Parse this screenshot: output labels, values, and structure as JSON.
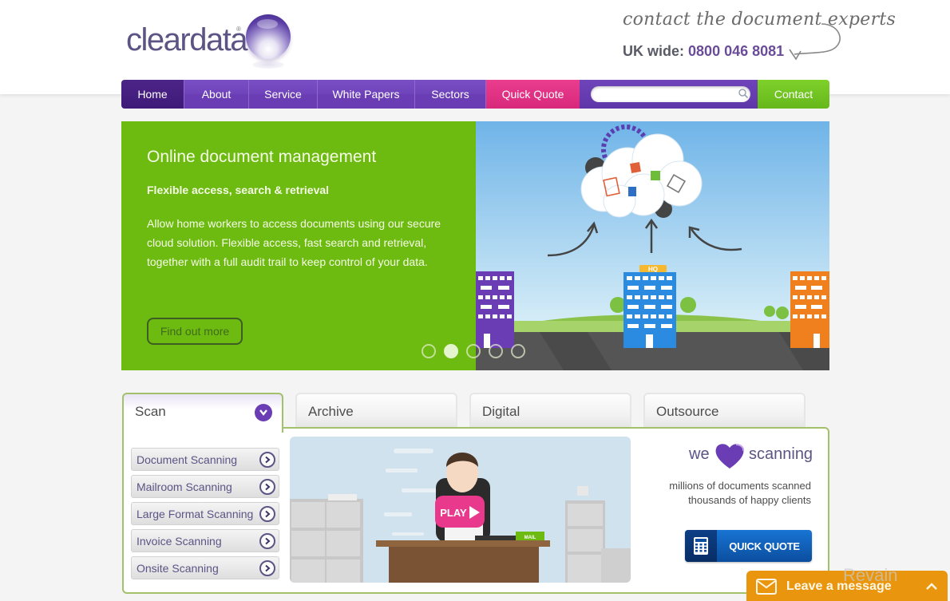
{
  "brand": {
    "logo_text": "cleardata",
    "logo_reg": "®",
    "accent_purple": "#6a3db4",
    "accent_green": "#6dbb10",
    "accent_pink": "#e0307f"
  },
  "contact": {
    "tagline": "contact the document experts",
    "phone_label": "UK wide:",
    "phone_number": "0800 046 8081"
  },
  "nav": {
    "items": [
      {
        "label": "Home",
        "active": true
      },
      {
        "label": "About"
      },
      {
        "label": "Service"
      },
      {
        "label": "White Papers"
      },
      {
        "label": "Sectors"
      },
      {
        "label": "Quick Quote"
      }
    ],
    "search_value": "",
    "search_placeholder": "",
    "contact_label": "Contact"
  },
  "hero": {
    "title": "Online document management",
    "subtitle": "Flexible access, search & retrieval",
    "body": "Allow home workers to access documents using our secure cloud solution. Flexible access, fast search and retrieval, together with a full audit trail to keep control of your data.",
    "button_label": "Find out more",
    "illustration_badge": "HQ",
    "slide_count": 5,
    "active_slide": 2
  },
  "tabs": [
    {
      "label": "Scan",
      "active": true
    },
    {
      "label": "Archive"
    },
    {
      "label": "Digital"
    },
    {
      "label": "Outsource"
    }
  ],
  "scan_panel": {
    "services": [
      {
        "label": "Document Scanning"
      },
      {
        "label": "Mailroom Scanning"
      },
      {
        "label": "Large Format Scanning"
      },
      {
        "label": "Invoice Scanning"
      },
      {
        "label": "Onsite Scanning"
      }
    ],
    "video": {
      "play_label": "PLAY",
      "mail_tag": "MAIL"
    },
    "promo": {
      "we": "we",
      "scanning": "scanning",
      "line1": "millions of documents scanned",
      "line2": "thousands of happy clients",
      "quick_quote_label": "QUICK QUOTE"
    }
  },
  "chat_widget": {
    "label": "Leave a message"
  },
  "watermark": {
    "text": "Revain"
  }
}
